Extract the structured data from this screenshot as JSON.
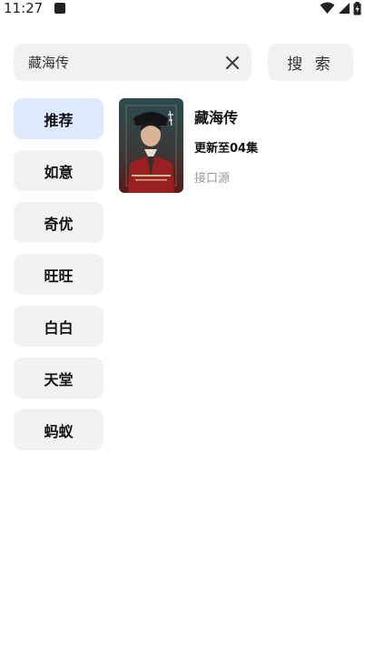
{
  "status_bar": {
    "time": "11:27"
  },
  "search": {
    "value": "藏海传",
    "button_label": "搜 索"
  },
  "sources": [
    {
      "label": "推荐",
      "selected": true
    },
    {
      "label": "如意",
      "selected": false
    },
    {
      "label": "奇优",
      "selected": false
    },
    {
      "label": "旺旺",
      "selected": false
    },
    {
      "label": "白白",
      "selected": false
    },
    {
      "label": "天堂",
      "selected": false
    },
    {
      "label": "蚂蚁",
      "selected": false
    }
  ],
  "results": [
    {
      "title": "藏海传",
      "update": "更新至04集",
      "source": "接口源"
    }
  ],
  "colors": {
    "selected_source_bg": "#dce9fe",
    "tile_bg": "#f2f2f2",
    "muted_text": "#999999"
  }
}
